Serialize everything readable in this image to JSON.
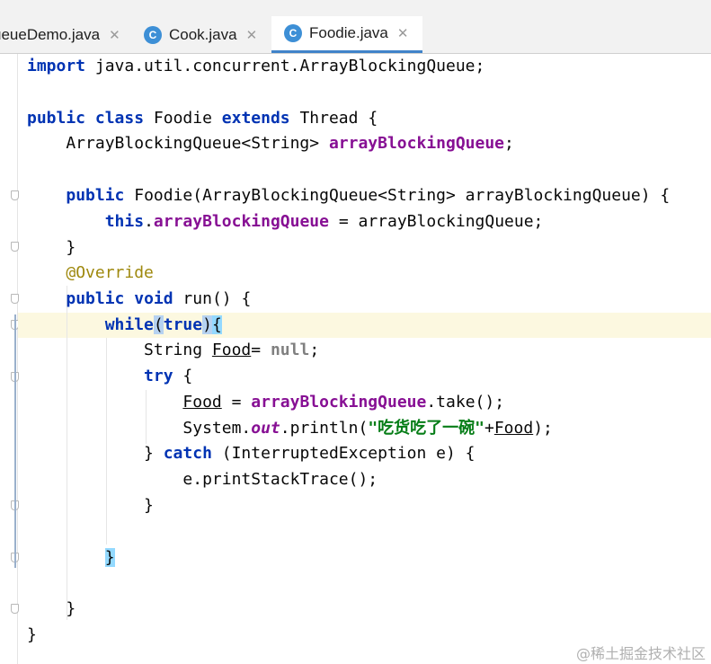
{
  "tabs": [
    {
      "label": "ueueDemo.java",
      "active": false,
      "icon": null
    },
    {
      "label": "Cook.java",
      "active": false,
      "icon": "C"
    },
    {
      "label": "Foodie.java",
      "active": true,
      "icon": "C"
    }
  ],
  "close_glyph": "✕",
  "code": {
    "l1": {
      "a": "import",
      "b": " java.util.concurrent.ArrayBlockingQueue;"
    },
    "l3": {
      "a": "public",
      "b": " ",
      "c": "class",
      "d": " Foodie ",
      "e": "extends",
      "f": " Thread {"
    },
    "l4": {
      "a": "    ArrayBlockingQueue<String> ",
      "b": "arrayBlockingQueue",
      "c": ";"
    },
    "l6": {
      "a": "    ",
      "b": "public",
      "c": " Foodie(ArrayBlockingQueue<String> arrayBlockingQueue) {"
    },
    "l7": {
      "a": "        ",
      "b": "this",
      "c": ".",
      "d": "arrayBlockingQueue",
      "e": " = arrayBlockingQueue;"
    },
    "l8": {
      "a": "    }"
    },
    "l9": {
      "a": "    ",
      "b": "@Override"
    },
    "l10": {
      "a": "    ",
      "b": "public",
      "c": " ",
      "d": "void",
      "e": " run() {"
    },
    "l11": {
      "a": "        ",
      "b": "while",
      "c": "(",
      "d": "true",
      "e": ")",
      "f": "{"
    },
    "l12": {
      "a": "            String ",
      "b": "Food",
      "c": "= ",
      "d": "null",
      "e": ";"
    },
    "l13": {
      "a": "            ",
      "b": "try",
      "c": " {"
    },
    "l14": {
      "a": "                ",
      "b": "Food",
      "c": " = ",
      "d": "arrayBlockingQueue",
      "e": ".take();"
    },
    "l15": {
      "a": "                System.",
      "b": "out",
      "c": ".println(",
      "d": "\"吃货吃了一碗\"",
      "e": "+",
      "f": "Food",
      "g": ");"
    },
    "l16": {
      "a": "            } ",
      "b": "catch",
      "c": " (InterruptedException e) {"
    },
    "l17": {
      "a": "                e.printStackTrace();"
    },
    "l18": {
      "a": "            }"
    },
    "l20": {
      "a": "        ",
      "b": "}"
    },
    "l22": {
      "a": "    }"
    },
    "l23": {
      "a": "}"
    }
  },
  "watermark": "@稀土掘金技术社区"
}
